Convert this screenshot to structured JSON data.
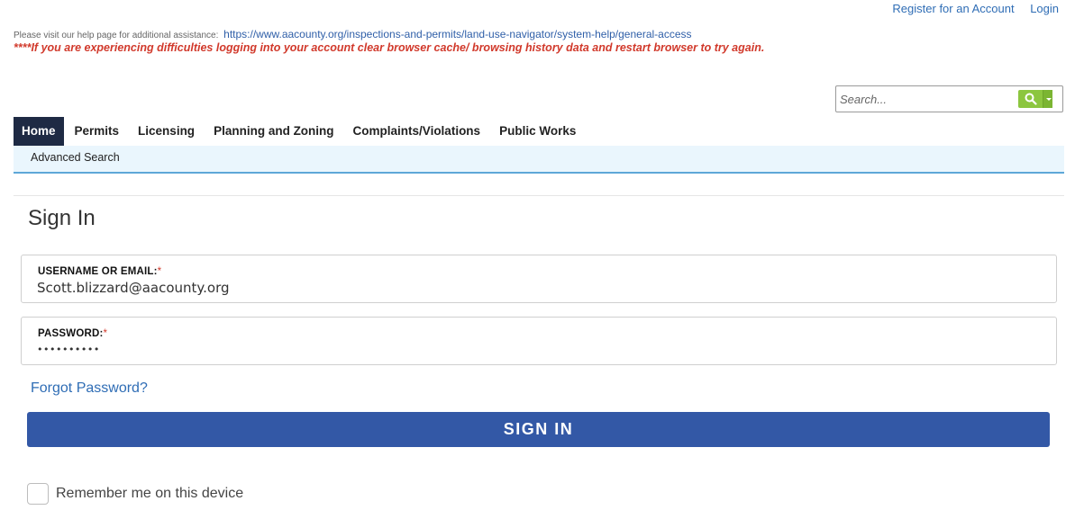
{
  "top_links": {
    "register": "Register for an Account",
    "login": "Login"
  },
  "help": {
    "prefix": "Please visit our help page for additional assistance:",
    "url": "https://www.aacounty.org/inspections-and-permits/land-use-navigator/system-help/general-access",
    "warning": "****If you are experiencing difficulties logging into your account clear browser cache/ browsing history data and restart browser to try again."
  },
  "search": {
    "placeholder": "Search..."
  },
  "nav": {
    "items": [
      {
        "label": "Home",
        "active": true
      },
      {
        "label": "Permits"
      },
      {
        "label": "Licensing"
      },
      {
        "label": "Planning and Zoning"
      },
      {
        "label": "Complaints/Violations"
      },
      {
        "label": "Public Works"
      }
    ],
    "sub": "Advanced Search"
  },
  "signin": {
    "title": "Sign In",
    "username_label": "USERNAME OR EMAIL:",
    "username_value": "Scott.blizzard@aacounty.org",
    "password_label": "PASSWORD:",
    "password_value": "••••••••••",
    "required_mark": "*",
    "forgot": "Forgot Password?",
    "button": "SIGN IN",
    "remember": "Remember me on this device"
  },
  "colors": {
    "nav_active": "#1e2a44",
    "button": "#3358a6",
    "link": "#2f6db5",
    "warning": "#d1392b",
    "search_button": "#8cc63f"
  }
}
